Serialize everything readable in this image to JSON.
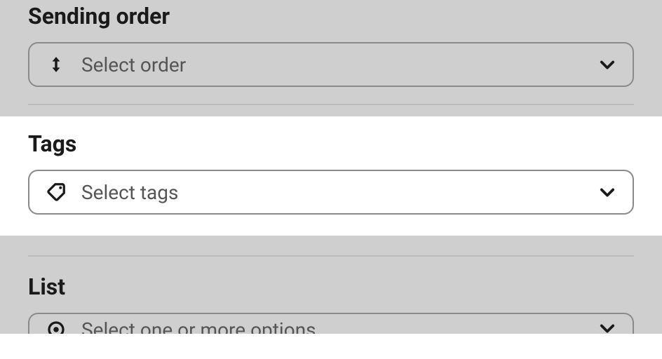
{
  "order": {
    "label": "Sending order",
    "placeholder": "Select order"
  },
  "tags": {
    "label": "Tags",
    "placeholder": "Select tags"
  },
  "list": {
    "label": "List",
    "placeholder": "Select one or more options"
  }
}
